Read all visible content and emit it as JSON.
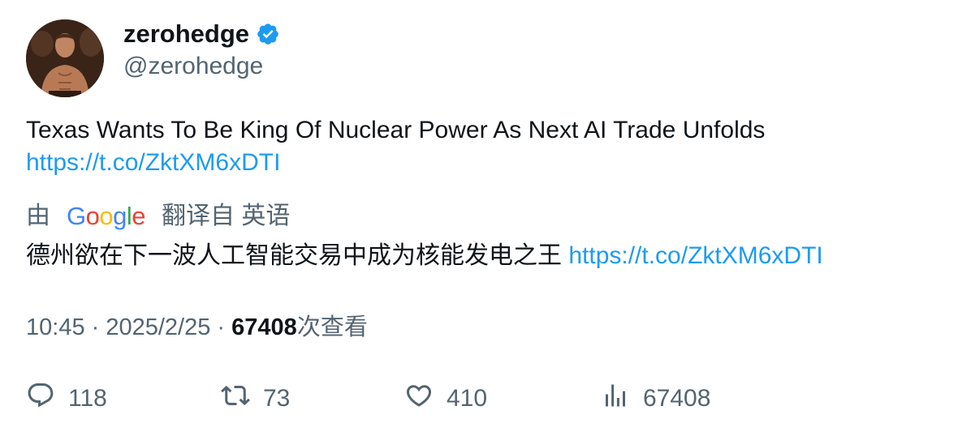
{
  "author": {
    "display_name": "zerohedge",
    "handle": "@zerohedge",
    "verified": true,
    "verified_color": "#1d9bf0"
  },
  "tweet": {
    "text": "Texas Wants To Be King Of Nuclear Power As Next AI Trade Unfolds",
    "link": "https://t.co/ZktXM6xDTI"
  },
  "translation": {
    "prefix": "由",
    "provider_letters": [
      "G",
      "o",
      "o",
      "g",
      "l",
      "e"
    ],
    "provider_colors": [
      "#4285F4",
      "#EA4335",
      "#FBBC05",
      "#4285F4",
      "#34A853",
      "#EA4335"
    ],
    "suffix": "翻译自 英语",
    "text": "德州欲在下一波人工智能交易中成为核能发电之王",
    "link": "https://t.co/ZktXM6xDTI"
  },
  "meta": {
    "time": "10:45",
    "separator": " · ",
    "date": "2025/2/25",
    "views_count": "67408",
    "views_label": "次查看"
  },
  "actions": {
    "replies": "118",
    "retweets": "73",
    "likes": "410",
    "views": "67408"
  },
  "colors": {
    "text": "#0f1419",
    "secondary": "#536471",
    "link": "#1d9bf0"
  }
}
